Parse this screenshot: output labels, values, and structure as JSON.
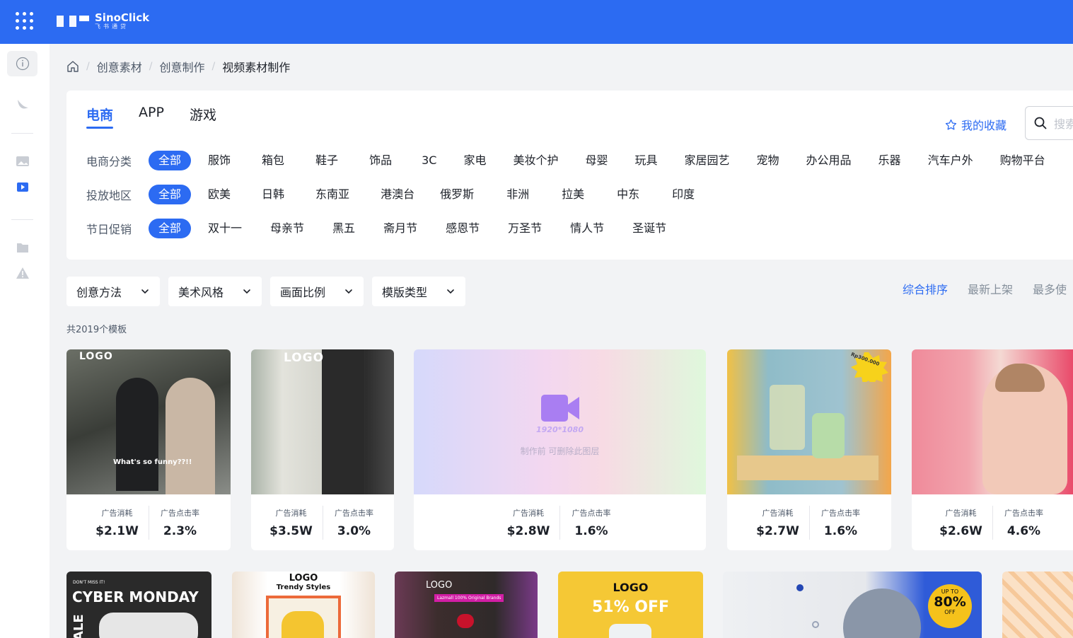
{
  "brand": {
    "name": "SinoClick",
    "sub": "飞书通贷"
  },
  "breadcrumb": {
    "items": [
      "创意素材",
      "创意制作"
    ],
    "current": "视频素材制作"
  },
  "tabs": [
    {
      "label": "电商",
      "active": true
    },
    {
      "label": "APP",
      "active": false
    },
    {
      "label": "游戏",
      "active": false
    }
  ],
  "favorites_label": "我的收藏",
  "search_placeholder": "搜索",
  "filters": [
    {
      "label": "电商分类",
      "options": [
        "全部",
        "服饰",
        "箱包",
        "鞋子",
        "饰品",
        "3C",
        "家电",
        "美妆个护",
        "母婴",
        "玩具",
        "家居园艺",
        "宠物",
        "办公用品",
        "乐器",
        "汽车户外",
        "购物平台"
      ]
    },
    {
      "label": "投放地区",
      "options": [
        "全部",
        "欧美",
        "日韩",
        "东南亚",
        "港澳台",
        "俄罗斯",
        "非洲",
        "拉美",
        "中东",
        "印度"
      ]
    },
    {
      "label": "节日促销",
      "options": [
        "全部",
        "双十一",
        "母亲节",
        "黑五",
        "斋月节",
        "感恩节",
        "万圣节",
        "情人节",
        "圣诞节"
      ]
    }
  ],
  "dropdowns": [
    "创意方法",
    "美术风格",
    "画面比例",
    "模版类型"
  ],
  "sorts": [
    "综合排序",
    "最新上架",
    "最多使"
  ],
  "total": "共2019个模板",
  "stat_labels": {
    "spend": "广告消耗",
    "ctr": "广告点击率"
  },
  "cards": [
    {
      "spend": "$2.1W",
      "ctr": "2.3%",
      "logo": "LOGO",
      "caption": "What's so funny??!!"
    },
    {
      "spend": "$3.5W",
      "ctr": "3.0%",
      "logo": "LOGO"
    },
    {
      "spend": "$2.8W",
      "ctr": "1.6%",
      "dims": "1920*1080",
      "note": "制作前 可删除此图层"
    },
    {
      "spend": "$2.7W",
      "ctr": "1.6%",
      "badge": "Rp300.000"
    },
    {
      "spend": "$2.6W",
      "ctr": "4.6%"
    }
  ],
  "row2": {
    "c1_top": "DON'T MISS IT!",
    "c1_title": "CYBER MONDAY",
    "c1_side": "ALE",
    "c2_logo": "LOGO",
    "c2_sub": "Trendy Styles",
    "c3_logo": "LOGO",
    "c3_strip": "Lazmall 100% Original Brands",
    "c4_logo": "LOGO",
    "c4_offer": "51% OFF",
    "c5_upto": "UP TO",
    "c5_pct": "80%",
    "c5_off": "OFF"
  },
  "colors": {
    "primary": "#2c6bf2",
    "bg": "#f2f3f5"
  }
}
